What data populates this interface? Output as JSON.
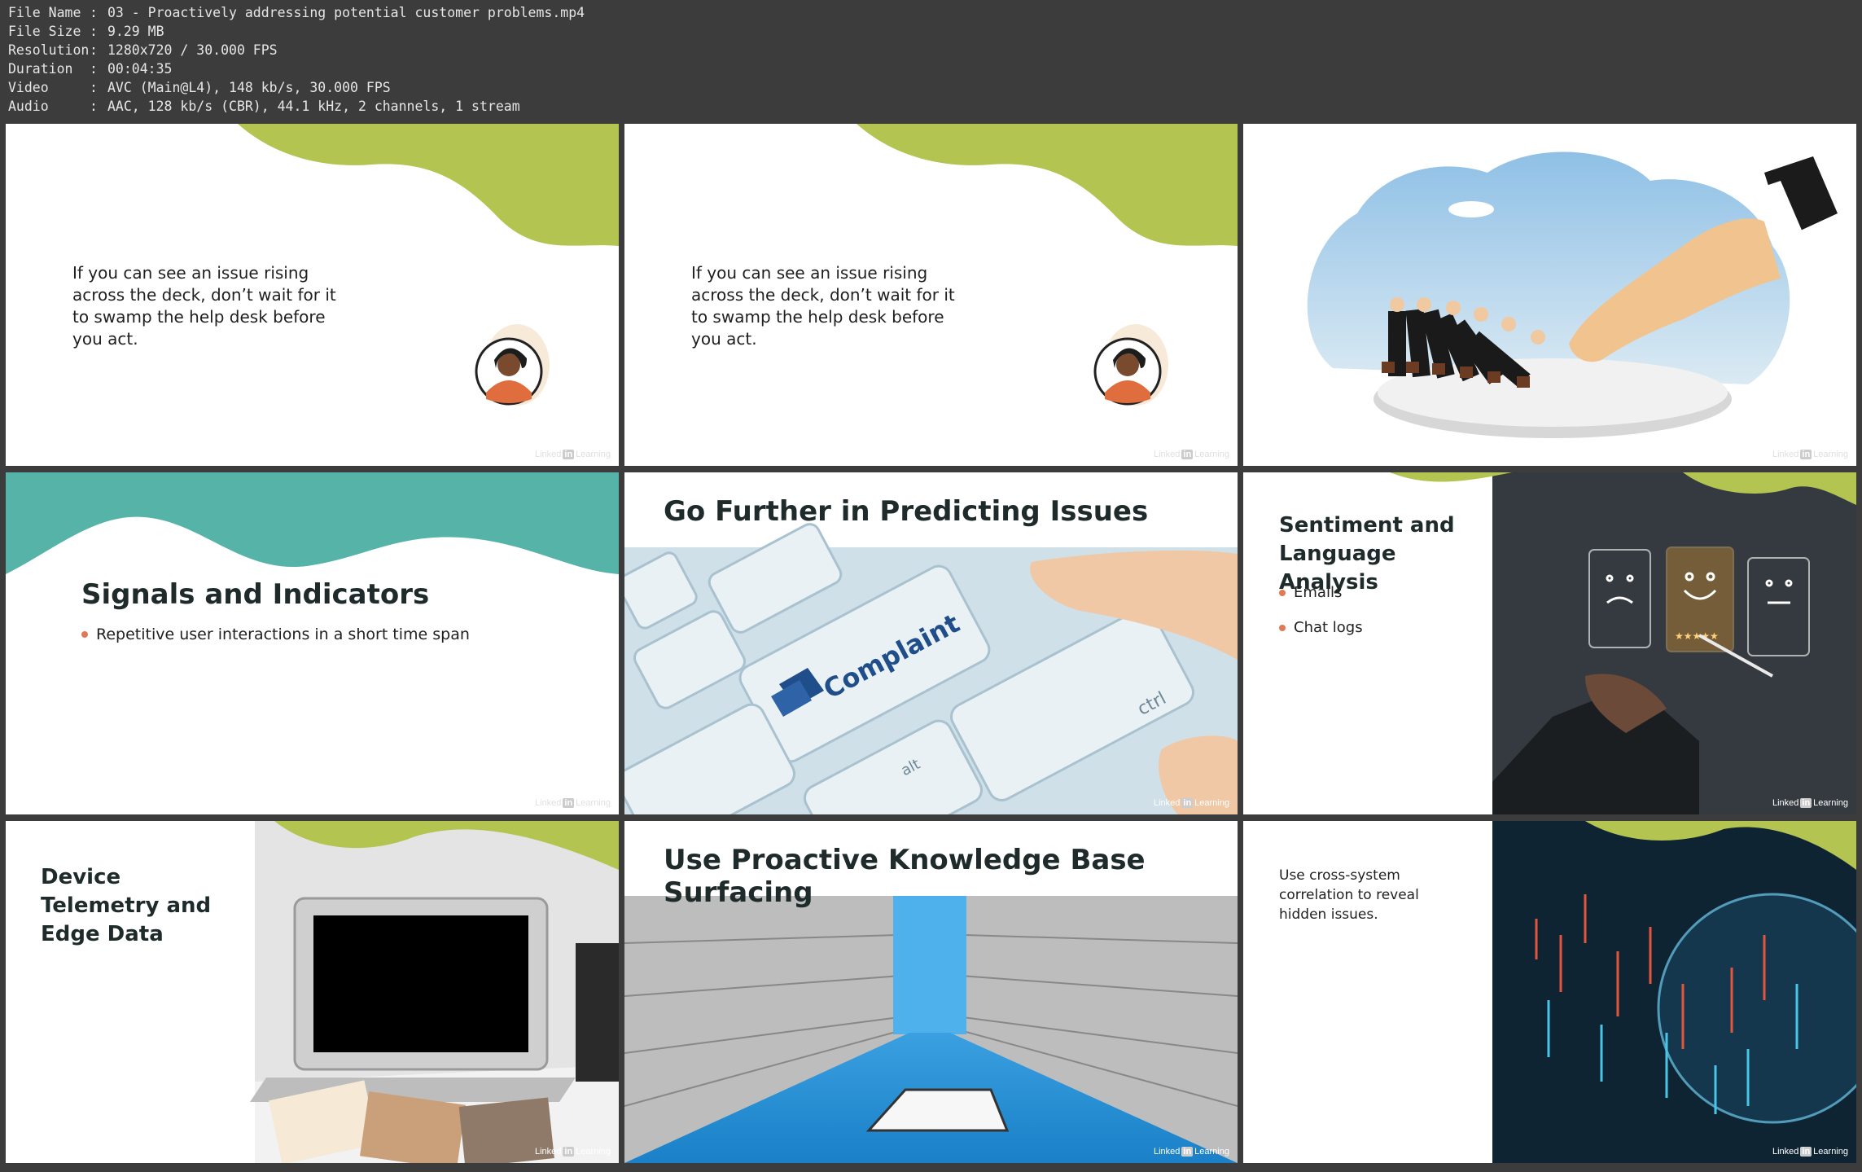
{
  "file_info": [
    {
      "key": "File Name",
      "value": "03 - Proactively addressing potential customer problems.mp4"
    },
    {
      "key": "File Size",
      "value": "9.29 MB"
    },
    {
      "key": "Resolution",
      "value": "1280x720 / 30.000 FPS"
    },
    {
      "key": "Duration",
      "value": "00:04:35"
    },
    {
      "key": "Video",
      "value": "AVC (Main@L4), 148 kb/s, 30.000 FPS"
    },
    {
      "key": "Audio",
      "value": "AAC, 128 kb/s (CBR), 44.1 kHz, 2 channels, 1 stream"
    }
  ],
  "separator": ":",
  "colors": {
    "green": "#b3c451",
    "teal": "#55b3a7",
    "accent": "#e07a55",
    "orange": "#e06d3d",
    "text": "#1f1f1f"
  },
  "brand": {
    "pre": "Linked",
    "in": "in",
    "post": "Learning"
  },
  "tiles": {
    "t1": {
      "quote": "If you can see an issue rising across the deck, don’t wait for it to swamp the help desk before you act."
    },
    "t2": {
      "quote": "If you can see an issue rising across the deck, don’t wait for it to swamp the help desk before you act."
    },
    "t3": {
      "image": "dominoes-businessmen-hand"
    },
    "t4": {
      "title": "Signals and Indicators",
      "bullets": [
        "Repetitive user interactions in a short time span"
      ]
    },
    "t5": {
      "title": "Go Further in Predicting Issues",
      "key_label": "Complaint",
      "ctrl": "ctrl",
      "alt": "alt"
    },
    "t6": {
      "title": "Sentiment and Language Analysis",
      "bullets": [
        "Emails",
        "Chat logs"
      ]
    },
    "t7": {
      "title": "Device Telemetry and Edge Data"
    },
    "t8": {
      "title": "Use Proactive Knowledge Base Surfacing"
    },
    "t9": {
      "text": "Use cross-system correlation to reveal hidden issues."
    }
  }
}
